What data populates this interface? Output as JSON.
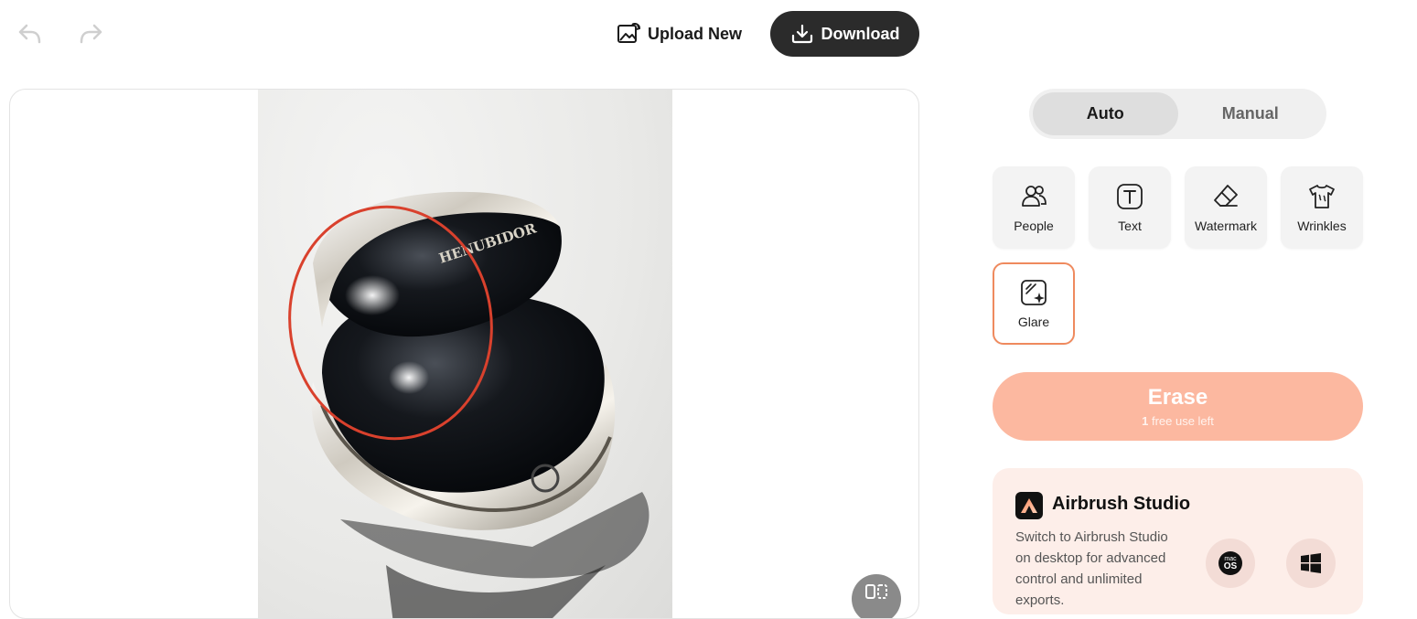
{
  "toolbar": {
    "upload_label": "Upload New",
    "download_label": "Download"
  },
  "mode": {
    "options": [
      "Auto",
      "Manual"
    ],
    "selected": "Auto"
  },
  "tools": [
    {
      "label": "People",
      "icon": "people-icon"
    },
    {
      "label": "Text",
      "icon": "text-icon"
    },
    {
      "label": "Watermark",
      "icon": "eraser-icon"
    },
    {
      "label": "Wrinkles",
      "icon": "shirt-icon"
    },
    {
      "label": "Glare",
      "icon": "glare-icon",
      "selected": true
    }
  ],
  "erase": {
    "label": "Erase",
    "uses_count": "1",
    "uses_text": "free use left"
  },
  "promo": {
    "title": "Airbrush Studio",
    "description": "Switch to Airbrush Studio on desktop for advanced control and unlimited exports.",
    "mac_badge_top": "mac",
    "mac_badge_bottom": "OS"
  },
  "image": {
    "brand_text": "HENUBIDOR"
  },
  "colors": {
    "accent": "#ef8a5e",
    "erase_bg": "#fcb8a0",
    "download_bg": "#2b2b2b",
    "highlight_circle": "#d9412d"
  }
}
